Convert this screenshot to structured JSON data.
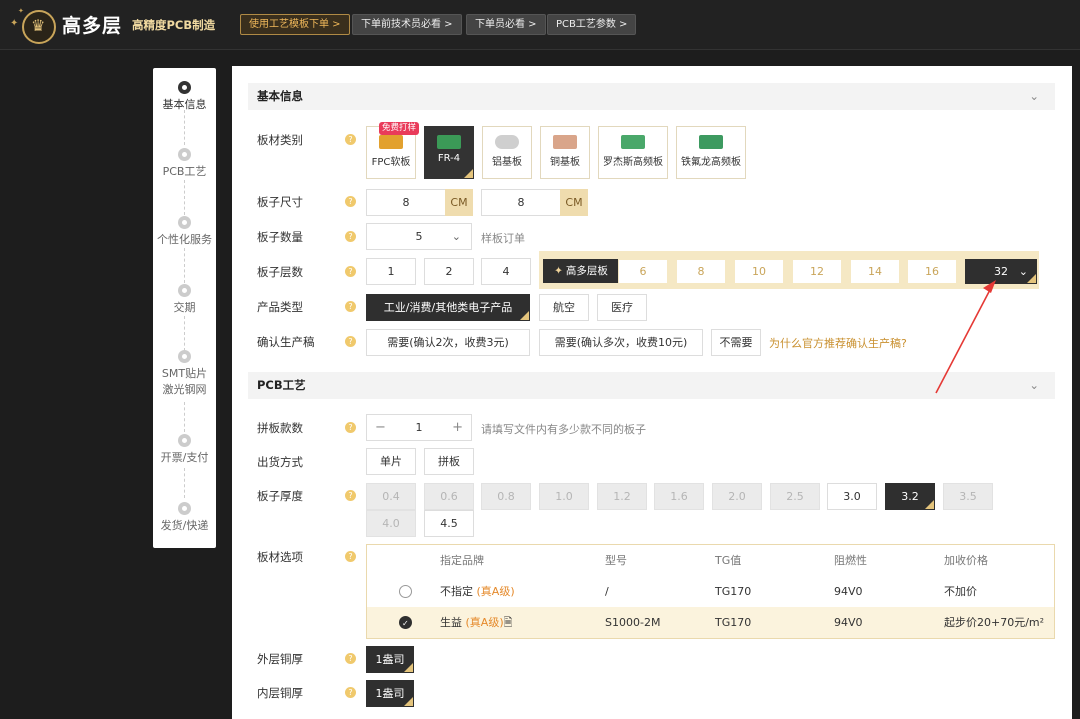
{
  "header": {
    "brand": "高多层",
    "slogan": "高精度PCB制造",
    "nav": [
      "使用工艺模板下单 >",
      "下单前技术员必看 >",
      "下单员必看 >",
      "PCB工艺参数 >"
    ]
  },
  "steps": [
    {
      "label": "基本信息"
    },
    {
      "label": "PCB工艺"
    },
    {
      "label": "个性化服务"
    },
    {
      "label": "交期"
    },
    {
      "label": "SMT贴片\n激光钢网"
    },
    {
      "label": "开票/支付"
    },
    {
      "label": "发货/快递"
    }
  ],
  "section_basic": {
    "title": "基本信息",
    "chevron": "⌄"
  },
  "section_pcb": {
    "title": "PCB工艺",
    "chevron": "⌄"
  },
  "q": "?",
  "material": {
    "label": "板材类别",
    "badge": "免费打样",
    "options": [
      "FPC软板",
      "FR-4",
      "铝基板",
      "铜基板",
      "罗杰斯高频板",
      "铁氟龙高频板"
    ]
  },
  "size": {
    "label": "板子尺寸",
    "w": "8",
    "h": "8",
    "unit": "CM"
  },
  "qty": {
    "label": "板子数量",
    "value": "5",
    "hint": "样板订单",
    "caret": "⌄"
  },
  "layers": {
    "label": "板子层数",
    "low": [
      "1",
      "2",
      "4"
    ],
    "high_label": "高多层板",
    "high_star": "✦",
    "high": [
      "6",
      "8",
      "10",
      "12",
      "14",
      "16"
    ],
    "selected": "32",
    "caret": "⌄"
  },
  "product": {
    "label": "产品类型",
    "options": [
      "工业/消费/其他类电子产品",
      "航空",
      "医疗"
    ]
  },
  "confirm": {
    "label": "确认生产稿",
    "options": [
      "需要(确认2次，收费3元)",
      "需要(确认多次，收费10元)",
      "不需要"
    ],
    "link": "为什么官方推荐确认生产稿?"
  },
  "panel_count": {
    "label": "拼板款数",
    "minus": "−",
    "value": "1",
    "plus": "+",
    "hint": "请填写文件内有多少款不同的板子"
  },
  "ship_mode": {
    "label": "出货方式",
    "options": [
      "单片",
      "拼板"
    ]
  },
  "thickness": {
    "label": "板子厚度",
    "row1": [
      "0.4",
      "0.6",
      "0.8",
      "1.0",
      "1.2",
      "1.6",
      "2.0",
      "2.5",
      "3.0",
      "3.2",
      "3.5"
    ],
    "row2": [
      "4.0",
      "4.5"
    ]
  },
  "material_opt": {
    "label": "板材选项",
    "headers": [
      "指定品牌",
      "型号",
      "TG值",
      "阻燃性",
      "加收价格"
    ],
    "rows": [
      {
        "brand": "不指定",
        "tag": "(真A级)",
        "model": "/",
        "tg": "TG170",
        "fr": "94V0",
        "price": "不加价"
      },
      {
        "brand": "生益",
        "tag": "(真A级)",
        "doc": "🗎",
        "model": "S1000-2M",
        "tg": "TG170",
        "fr": "94V0",
        "price": "起步价20+70元/m²"
      }
    ]
  },
  "outer_cu": {
    "label": "外层铜厚",
    "value": "1盎司"
  },
  "inner_cu": {
    "label": "内层铜厚",
    "value": "1盎司"
  }
}
